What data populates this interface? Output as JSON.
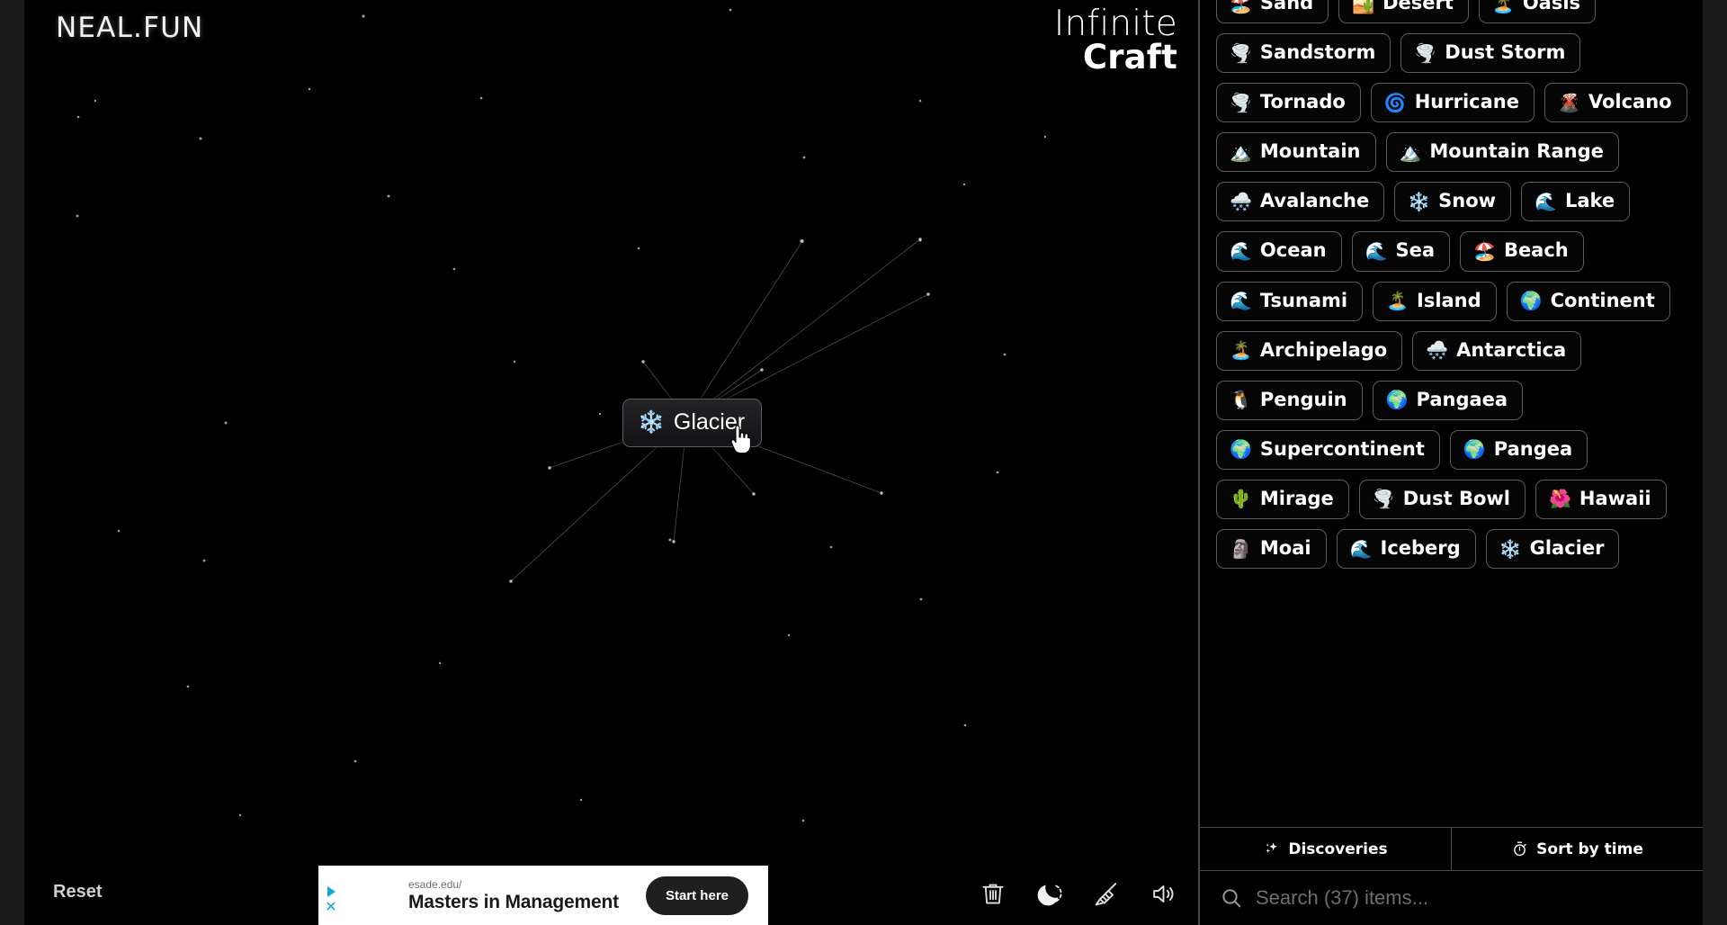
{
  "brand": {
    "neal_logo": "NEAL.FUN",
    "game_title_line1": "Infinite",
    "game_title_line2": "Craft"
  },
  "canvas": {
    "reset_label": "Reset",
    "node": {
      "emoji": "❄️",
      "label": "Glacier"
    },
    "tools": [
      {
        "name": "trash-icon",
        "label": "Clear all"
      },
      {
        "name": "moon-icon",
        "label": "Dark mode"
      },
      {
        "name": "broom-icon",
        "label": "Tidy up"
      },
      {
        "name": "speaker-icon",
        "label": "Sound"
      }
    ]
  },
  "ad": {
    "url": "esade.edu/",
    "title": "Masters in Management",
    "cta": "Start here",
    "play_icon": "play-icon",
    "close_icon": "close-icon"
  },
  "sidebar": {
    "items": [
      {
        "emoji": "🏖️",
        "label": "Sand"
      },
      {
        "emoji": "🏜️",
        "label": "Desert"
      },
      {
        "emoji": "🏝️",
        "label": "Oasis"
      },
      {
        "emoji": "🌪️",
        "label": "Sandstorm"
      },
      {
        "emoji": "🌪️",
        "label": "Dust Storm"
      },
      {
        "emoji": "🌪️",
        "label": "Tornado"
      },
      {
        "emoji": "🌀",
        "label": "Hurricane"
      },
      {
        "emoji": "🌋",
        "label": "Volcano"
      },
      {
        "emoji": "🏔️",
        "label": "Mountain"
      },
      {
        "emoji": "🏔️",
        "label": "Mountain Range"
      },
      {
        "emoji": "🌨️",
        "label": "Avalanche"
      },
      {
        "emoji": "❄️",
        "label": "Snow"
      },
      {
        "emoji": "🌊",
        "label": "Lake"
      },
      {
        "emoji": "🌊",
        "label": "Ocean"
      },
      {
        "emoji": "🌊",
        "label": "Sea"
      },
      {
        "emoji": "🏖️",
        "label": "Beach"
      },
      {
        "emoji": "🌊",
        "label": "Tsunami"
      },
      {
        "emoji": "🏝️",
        "label": "Island"
      },
      {
        "emoji": "🌍",
        "label": "Continent"
      },
      {
        "emoji": "🏝️",
        "label": "Archipelago"
      },
      {
        "emoji": "🌨️",
        "label": "Antarctica"
      },
      {
        "emoji": "🐧",
        "label": "Penguin"
      },
      {
        "emoji": "🌍",
        "label": "Pangaea"
      },
      {
        "emoji": "🌍",
        "label": "Supercontinent"
      },
      {
        "emoji": "🌍",
        "label": "Pangea"
      },
      {
        "emoji": "🌵",
        "label": "Mirage"
      },
      {
        "emoji": "🌪️",
        "label": "Dust Bowl"
      },
      {
        "emoji": "🌺",
        "label": "Hawaii"
      },
      {
        "emoji": "🗿",
        "label": "Moai"
      },
      {
        "emoji": "🌊",
        "label": "Iceberg"
      },
      {
        "emoji": "❄️",
        "label": "Glacier"
      }
    ],
    "sort": {
      "discoveries_label": "Discoveries",
      "discoveries_icon": "sparkles-icon",
      "time_label": "Sort by time",
      "time_icon": "stopwatch-icon"
    },
    "search": {
      "placeholder": "Search (37) items...",
      "value": "",
      "icon": "search-icon",
      "item_count": 37
    }
  },
  "colors": {
    "background": "#000000",
    "page_border": "#1c1c1c",
    "item_border": "#5a5a5a",
    "divider": "#4a4a4a",
    "accent_blue": "#16a5d9"
  }
}
